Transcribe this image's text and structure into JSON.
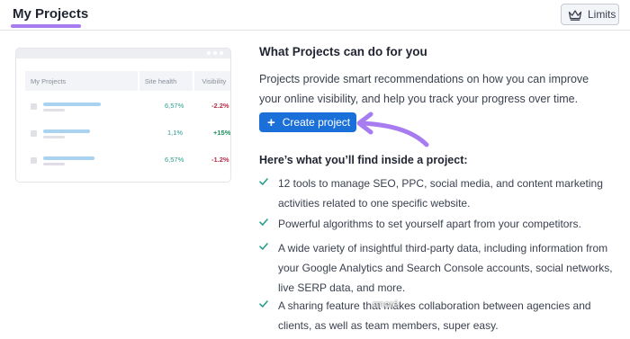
{
  "header": {
    "title": "My Projects",
    "limits_label": "Limits",
    "limits_icon": "crown-icon"
  },
  "preview": {
    "columns": [
      "My Projects",
      "Site health",
      "Visibility"
    ],
    "rows": [
      {
        "site_health": "6,57%",
        "visibility": "-2.2%",
        "trend": "negative"
      },
      {
        "site_health": "1,1%",
        "visibility": "+15%",
        "trend": "positive"
      },
      {
        "site_health": "6,57%",
        "visibility": "-1.2%",
        "trend": "negative"
      }
    ]
  },
  "info": {
    "title": "What Projects can do for you",
    "intro": "Projects provide smart recommendations on how you can improve your online visibility, and help you track your progress over time.",
    "create_button": "Create project",
    "subheading": "Here’s what you’ll find inside a project:",
    "features": [
      "12 tools to manage SEO, PPC, social media, and content marketing activities related to one specific website.",
      "Powerful algorithms to set yourself apart from your competitors.",
      "A wide variety of insightful third-party data, including information from your Google Analytics and Search Console accounts, social networks, live SERP data, and more.",
      "A sharing feature that makes collaboration between agencies and clients, as well as team members, super easy."
    ]
  },
  "colors": {
    "accent": "#1a6fd8",
    "highlight": "#a77cf0",
    "check": "#2a9d8f"
  },
  "watermark": "rmoré"
}
